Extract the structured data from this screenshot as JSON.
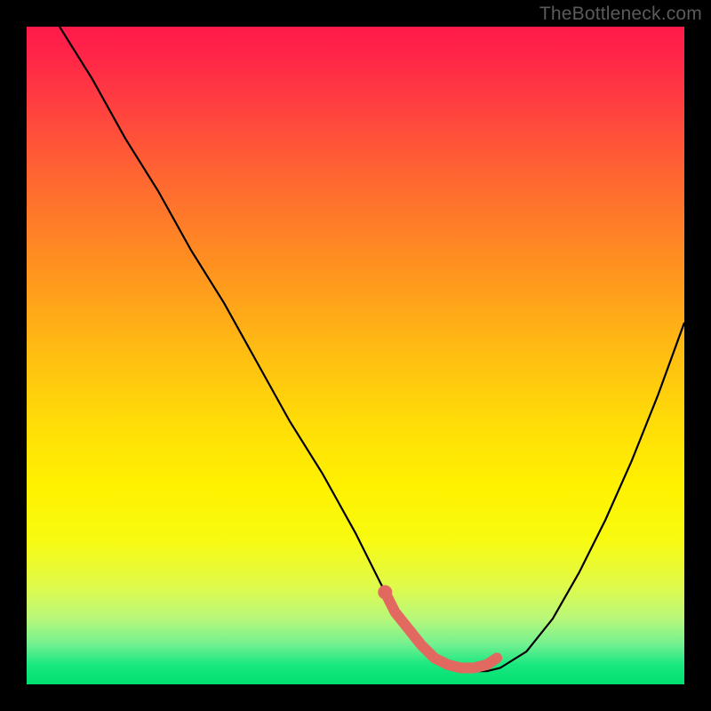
{
  "watermark": "TheBottleneck.com",
  "chart_data": {
    "type": "line",
    "title": "",
    "xlabel": "",
    "ylabel": "",
    "xlim": [
      0,
      100
    ],
    "ylim": [
      0,
      100
    ],
    "series": [
      {
        "name": "curve",
        "x": [
          5,
          10,
          15,
          20,
          25,
          30,
          35,
          40,
          45,
          50,
          54,
          56,
          58,
          60,
          62,
          64,
          66,
          68,
          70,
          72,
          76,
          80,
          84,
          88,
          92,
          96,
          100
        ],
        "values": [
          100,
          92,
          83,
          75,
          66,
          58,
          49,
          40,
          32,
          23,
          15,
          12,
          9,
          6,
          4,
          2.5,
          2,
          2,
          2,
          2.5,
          5,
          10,
          17,
          25,
          34,
          44,
          55
        ]
      },
      {
        "name": "highlight",
        "x": [
          54.5,
          56,
          58,
          60,
          62,
          64,
          66,
          68,
          70,
          71.5
        ],
        "values": [
          14,
          11,
          8.5,
          6,
          4,
          3,
          2.5,
          2.5,
          3,
          4
        ]
      }
    ],
    "highlight_dot": {
      "x": 54.5,
      "y": 14
    },
    "gradient_stops": [
      {
        "pos": 0,
        "color": "#ff1a4a"
      },
      {
        "pos": 24,
        "color": "#ff6a30"
      },
      {
        "pos": 48,
        "color": "#ffb814"
      },
      {
        "pos": 70,
        "color": "#fff200"
      },
      {
        "pos": 90,
        "color": "#b8f87a"
      },
      {
        "pos": 100,
        "color": "#00e070"
      }
    ]
  }
}
